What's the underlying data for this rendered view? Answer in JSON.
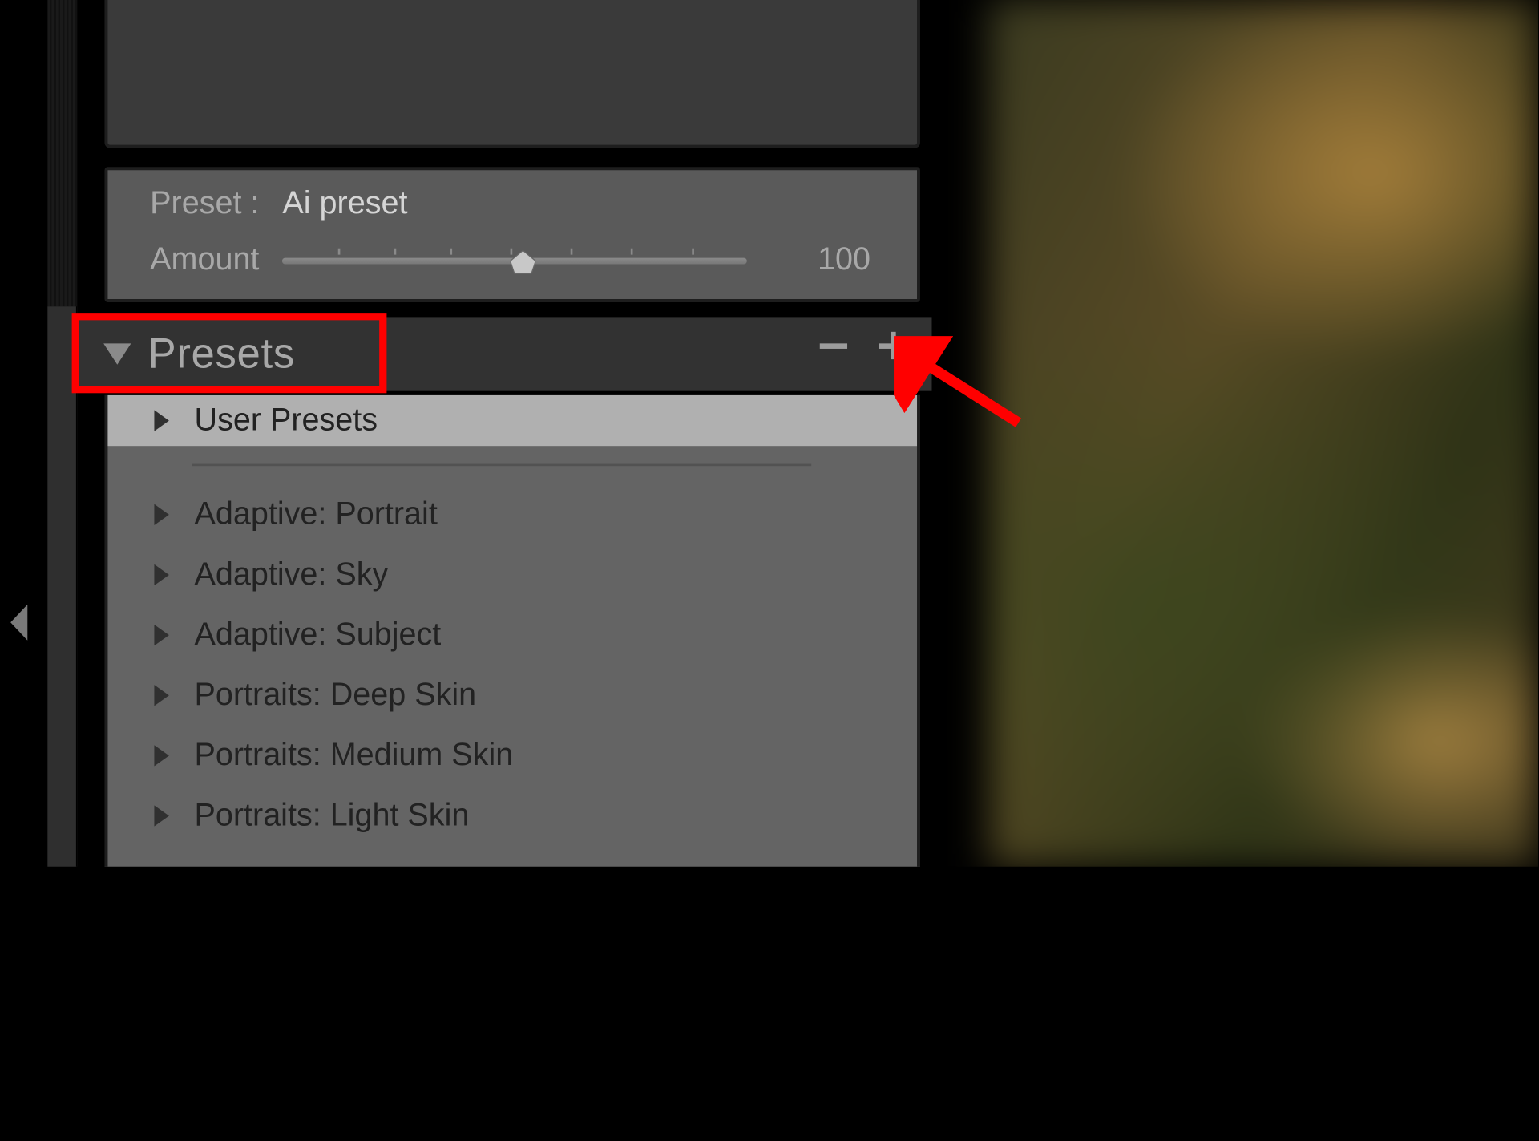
{
  "preset_info": {
    "preset_label": "Preset :",
    "preset_value": "Ai preset",
    "amount_label": "Amount",
    "amount_value": "100",
    "amount_percent": 50
  },
  "presets_panel": {
    "title": "Presets",
    "user_group": "User Presets",
    "groups": [
      "Adaptive: Portrait",
      "Adaptive: Sky",
      "Adaptive: Subject",
      "Portraits: Deep Skin",
      "Portraits: Medium Skin",
      "Portraits: Light Skin"
    ]
  },
  "annotation": {
    "highlight_target": "presets-header",
    "arrow_target": "add-preset-button"
  }
}
